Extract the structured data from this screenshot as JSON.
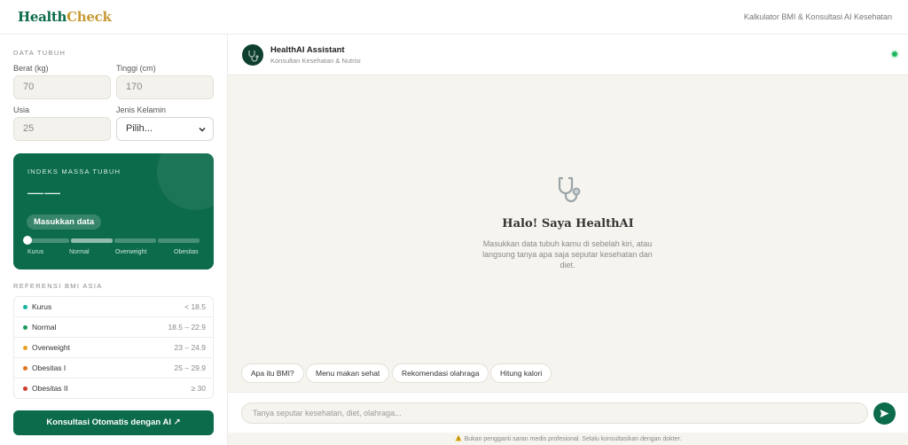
{
  "header": {
    "logo_part1": "Health",
    "logo_part2": "Check",
    "subtitle": "Kalkulator BMI & Konsultasi AI Kesehatan"
  },
  "form": {
    "section_title": "DATA TUBUH",
    "weight_label": "Berat (kg)",
    "weight_placeholder": "70",
    "height_label": "Tinggi (cm)",
    "height_placeholder": "170",
    "age_label": "Usia",
    "age_placeholder": "25",
    "gender_label": "Jenis Kelamin",
    "gender_selected": "Pilih..."
  },
  "bmi": {
    "title": "INDEKS MASSA TUBUH",
    "value": "——",
    "status": "Masukkan data",
    "indicator_level": 0,
    "categories": [
      "Kurus",
      "Normal",
      "Overweight",
      "Obesitas"
    ]
  },
  "reference": {
    "title": "REFERENSI BMI ASIA",
    "rows": [
      {
        "name": "Kurus",
        "range": "< 18.5",
        "color": "#17b6a3"
      },
      {
        "name": "Normal",
        "range": "18.5 – 22.9",
        "color": "#1a9a5a"
      },
      {
        "name": "Overweight",
        "range": "23 – 24.9",
        "color": "#e9a21f"
      },
      {
        "name": "Obesitas I",
        "range": "25 – 29.9",
        "color": "#e2741a"
      },
      {
        "name": "Obesitas II",
        "range": "≥ 30",
        "color": "#d43a2a"
      }
    ]
  },
  "consult_button": "Konsultasi Otomatis dengan AI ↗",
  "chat": {
    "assistant_name": "HealthAI Assistant",
    "assistant_sub": "Konsultan Kesehatan & Nutrisi",
    "welcome_title": "Halo! Saya HealthAI",
    "welcome_text": "Masukkan data tubuh kamu di sebelah kiri, atau langsung tanya apa saja seputar kesehatan dan diet.",
    "chips": [
      "Apa itu BMI?",
      "Menu makan sehat",
      "Rekomendasi olahraga",
      "Hitung kalori"
    ],
    "input_placeholder": "Tanya seputar kesehatan, diet, olahraga...",
    "disclaimer": "Bukan pengganti saran medis profesional. Selalu konsultasikan dengan dokter."
  },
  "colors": {
    "brand_green": "#0b6b4a",
    "brand_gold": "#c79a35",
    "online": "#1fb55c"
  }
}
